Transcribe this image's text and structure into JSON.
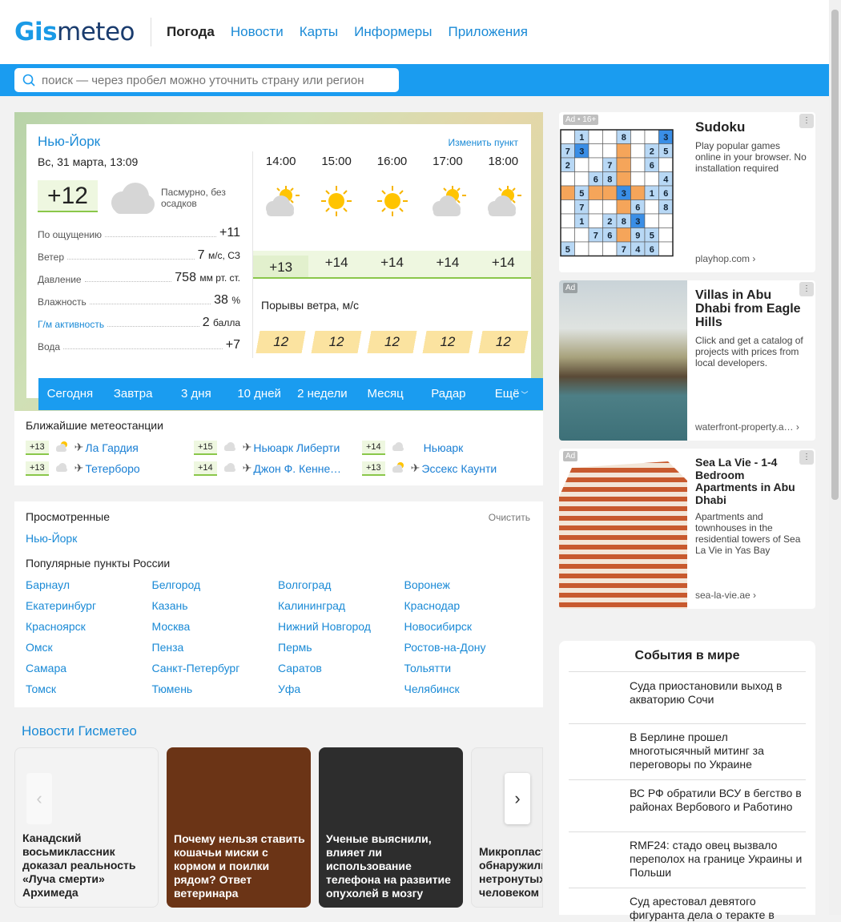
{
  "header": {
    "logo_gis": "Gis",
    "logo_meteo": "meteo",
    "nav": [
      "Погода",
      "Новости",
      "Карты",
      "Информеры",
      "Приложения"
    ]
  },
  "search": {
    "placeholder": "поиск — через пробел можно уточнить страну или регион"
  },
  "weather": {
    "city": "Нью-Йорк",
    "change": "Изменить пункт",
    "date": "Вс, 31 марта, 13:09",
    "temp": "+12",
    "desc": "Пасмурно, без осадков",
    "params": [
      {
        "label": "По ощущению",
        "value": "+11",
        "unit": ""
      },
      {
        "label": "Ветер",
        "value": "7",
        "unit": "м/с, СЗ"
      },
      {
        "label": "Давление",
        "value": "758",
        "unit": "мм рт. ст."
      },
      {
        "label": "Влажность",
        "value": "38",
        "unit": "%"
      },
      {
        "label": "Г/м активность",
        "value": "2",
        "unit": "балла"
      },
      {
        "label": "Вода",
        "value": "+7",
        "unit": ""
      }
    ],
    "hours": [
      "14:00",
      "15:00",
      "16:00",
      "17:00",
      "18:00"
    ],
    "hour_icons": [
      "partly-cloudy-icon",
      "sun-icon",
      "sun-icon",
      "partly-cloudy-icon",
      "partly-cloudy-icon"
    ],
    "hour_temps": [
      "+13",
      "+14",
      "+14",
      "+14",
      "+14"
    ],
    "gust_label": "Порывы ветра, м/с",
    "gusts": [
      "12",
      "12",
      "12",
      "12",
      "12"
    ],
    "tabs": [
      "Сегодня",
      "Завтра",
      "3 дня",
      "10 дней",
      "2 недели",
      "Месяц",
      "Радар",
      "Ещё"
    ]
  },
  "stations": {
    "title": "Ближайшие метеостанции",
    "items": [
      {
        "temp": "+13",
        "name": "Ла Гардия",
        "plane": "✈"
      },
      {
        "temp": "+15",
        "name": "Ньюарк Либерти",
        "plane": "✈"
      },
      {
        "temp": "+14",
        "name": "Ньюарк",
        "plane": ""
      },
      {
        "temp": "+13",
        "name": "Тетерборо",
        "plane": "✈"
      },
      {
        "temp": "+14",
        "name": "Джон Ф. Кеннеди",
        "plane": "✈"
      },
      {
        "temp": "+13",
        "name": "Эссекс Каунти",
        "plane": "✈"
      }
    ]
  },
  "viewed": {
    "title": "Просмотренные",
    "clear": "Очистить",
    "items": [
      "Нью-Йорк"
    ],
    "popular_title": "Популярные пункты России",
    "popular": [
      "Барнаул",
      "Белгород",
      "Волгоград",
      "Воронеж",
      "Екатеринбург",
      "Казань",
      "Калининград",
      "Краснодар",
      "Красноярск",
      "Москва",
      "Нижний Новгород",
      "Новосибирск",
      "Омск",
      "Пенза",
      "Пермь",
      "Ростов-на-Дону",
      "Самара",
      "Санкт-Петербург",
      "Саратов",
      "Тольятти",
      "Томск",
      "Тюмень",
      "Уфа",
      "Челябинск"
    ]
  },
  "news": {
    "title": "Новости Гисметео",
    "items": [
      "Канадский восьмиклассник доказал реальность «Луча смерти» Архимеда",
      "Почему нельзя ставить кошачьи миски с кормом и поилки рядом? Ответ ветеринара",
      "Ученые выяснили, влияет ли использование телефона на развитие опухолей в мозгу",
      "Микропласт обнаружили нетронутых современн человеком отложениях"
    ]
  },
  "ads": [
    {
      "badge": "Ad • 16+",
      "title": "Sudoku",
      "text": "Play popular games online in your browser. No installation required",
      "domain": "playhop.com ›"
    },
    {
      "badge": "Ad",
      "title": "Villas in Abu Dhabi from Eagle Hills",
      "text": "Click and get a catalog of projects with prices from local developers.",
      "domain": "waterfront-property.a…  ›"
    },
    {
      "badge": "Ad",
      "title": "Sea La Vie - 1-4 Bedroom Apartments in Abu Dhabi",
      "text": "Apartments and townhouses in the residential towers of Sea La Vie in Yas Bay",
      "domain": "sea-la-vie.ae ›"
    }
  ],
  "sudoku": [
    [
      "",
      "1",
      "",
      "",
      "8",
      "",
      "",
      "3"
    ],
    [
      "7",
      "3",
      "",
      "",
      "",
      "",
      "2",
      "5"
    ],
    [
      "2",
      "",
      "",
      "7",
      "",
      "",
      "6",
      ""
    ],
    [
      "",
      "",
      "6",
      "8",
      "",
      "",
      "",
      "4"
    ],
    [
      "",
      "5",
      "",
      "",
      "3",
      "",
      "1",
      "6"
    ],
    [
      "",
      "7",
      "",
      "",
      "",
      "6",
      "",
      "8"
    ],
    [
      "",
      "1",
      "",
      "2",
      "8",
      "3",
      "",
      ""
    ],
    [
      "",
      "",
      "7",
      "6",
      "",
      "9",
      "5",
      ""
    ],
    [
      "5",
      "",
      "",
      "",
      "7",
      "4",
      "6",
      ""
    ]
  ],
  "events": {
    "title": "События в мире",
    "items": [
      "Суда приостановили выход в акваторию Сочи",
      "В Берлине прошел многотысячный митинг за переговоры по Украине",
      "ВС РФ обратили ВСУ в бегство в районах Вербового и Работино",
      "RMF24: стадо овец вызвало переполох на границе Украины и Польши",
      "Суд арестовал девятого фигуранта дела о теракте в"
    ]
  },
  "colors": {
    "accent": "#1a9cf0",
    "link": "#1a8ad6",
    "temp_green": "#8ac74a",
    "gust": "#fbe3a0"
  }
}
